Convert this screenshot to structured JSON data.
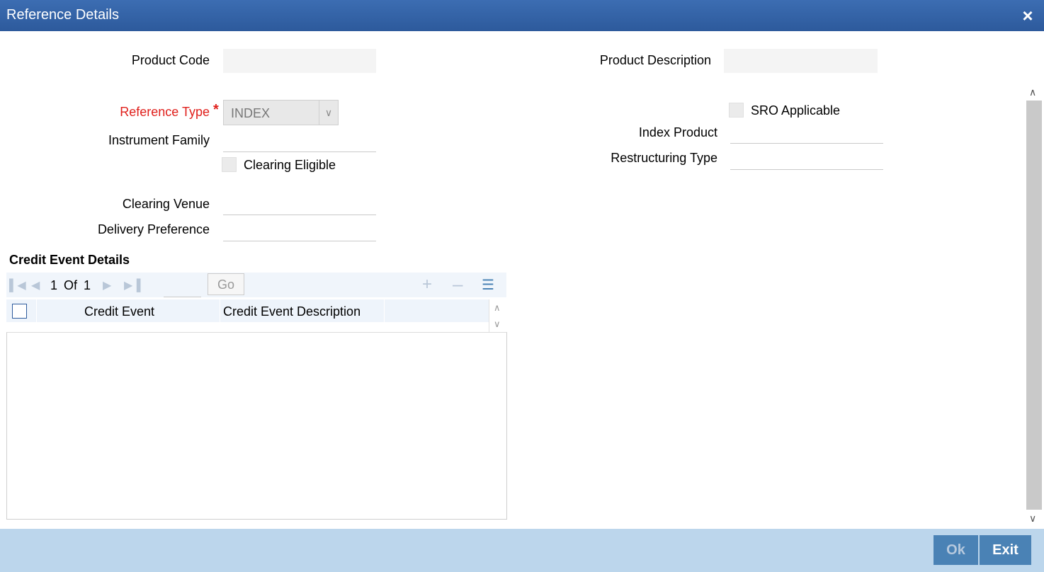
{
  "window": {
    "title": "Reference Details",
    "close_icon": "×"
  },
  "form": {
    "product_code_label": "Product Code",
    "product_code_value": "",
    "product_description_label": "Product Description",
    "product_description_value": "",
    "reference_type_label": "Reference Type",
    "required_marker": "*",
    "reference_type_value": "INDEX",
    "instrument_family_label": "Instrument Family",
    "instrument_family_value": "",
    "clearing_eligible_label": "Clearing Eligible",
    "clearing_eligible_checked": false,
    "clearing_venue_label": "Clearing Venue",
    "clearing_venue_value": "",
    "delivery_preference_label": "Delivery Preference",
    "delivery_preference_value": "",
    "sro_applicable_label": "SRO Applicable",
    "sro_applicable_checked": false,
    "index_product_label": "Index Product",
    "index_product_value": "",
    "restructuring_type_label": "Restructuring Type",
    "restructuring_type_value": ""
  },
  "credit_events": {
    "section_title": "Credit Event Details",
    "pager": {
      "current": "1",
      "of_label": "Of",
      "total": "1",
      "go_label": "Go"
    },
    "columns": [
      "Credit Event",
      "Credit Event Description"
    ],
    "rows": []
  },
  "footer": {
    "ok_label": "Ok",
    "exit_label": "Exit"
  },
  "colors": {
    "title_bar": "#2d5a9c",
    "required": "#e0201c",
    "footer": "#bcd6ec",
    "button": "#4a82b5"
  }
}
